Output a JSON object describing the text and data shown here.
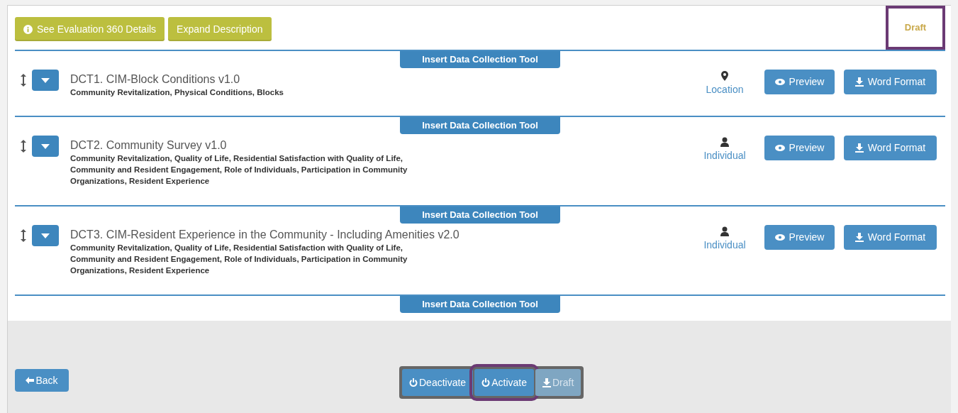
{
  "header_buttons": [
    {
      "kind": "info",
      "label": "See Evaluation 360 Details"
    },
    {
      "kind": "plain",
      "label": "Expand Description"
    }
  ],
  "status_tab": {
    "label": "Draft",
    "highlighted": true
  },
  "insert_labels": [
    "Insert Data Collection Tool",
    "Insert Data Collection Tool",
    "Insert Data Collection Tool",
    "Insert Data Collection Tool"
  ],
  "tools": [
    {
      "title": "DCT1. CIM-Block Conditions v1.0",
      "tags": "Community Revitalization, Physical Conditions, Blocks",
      "unit": {
        "kind": "location",
        "label": "Location"
      },
      "actions": [
        {
          "kind": "preview",
          "label": "Preview"
        },
        {
          "kind": "download",
          "label": "Word Format"
        }
      ]
    },
    {
      "title": "DCT2. Community Survey v1.0",
      "tags": "Community Revitalization, Quality of Life, Residential Satisfaction with Quality of Life, Community and Resident Engagement, Role of Individuals, Participation in Community Organizations, Resident Experience",
      "unit": {
        "kind": "individual",
        "label": "Individual"
      },
      "actions": [
        {
          "kind": "preview",
          "label": "Preview"
        },
        {
          "kind": "download",
          "label": "Word Format"
        }
      ]
    },
    {
      "title": "DCT3. CIM-Resident Experience in the Community - Including Amenities v2.0",
      "tags": "Community Revitalization, Quality of Life, Residential Satisfaction with Quality of Life, Community and Resident Engagement, Role of Individuals, Participation in Community Organizations, Resident Experience",
      "unit": {
        "kind": "individual",
        "label": "Individual"
      },
      "actions": [
        {
          "kind": "preview",
          "label": "Preview"
        },
        {
          "kind": "download",
          "label": "Word Format"
        }
      ]
    }
  ],
  "back_button": {
    "label": "Back"
  },
  "status_buttons": [
    {
      "kind": "power",
      "label": "Deactivate",
      "disabled": false,
      "highlighted": false
    },
    {
      "kind": "power",
      "label": "Activate",
      "disabled": false,
      "highlighted": true
    },
    {
      "kind": "download",
      "label": "Draft",
      "disabled": true,
      "highlighted": false
    }
  ]
}
